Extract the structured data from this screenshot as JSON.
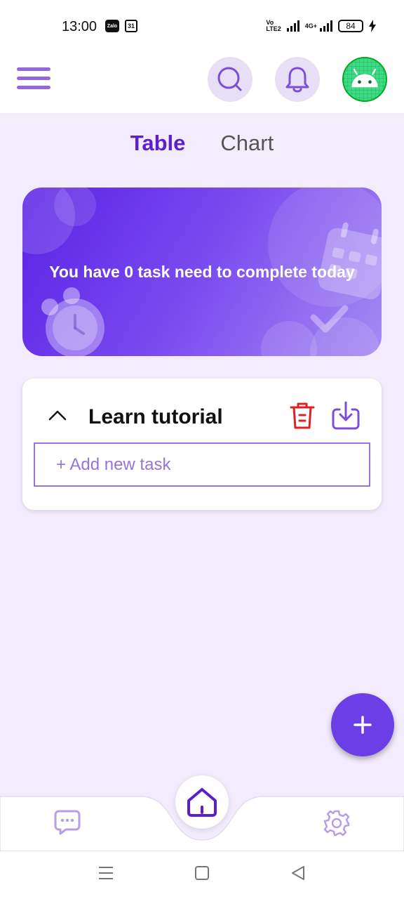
{
  "status_bar": {
    "time": "13:00",
    "zalo_badge": "Zalo",
    "calendar_badge": "31",
    "volte_label": "Vo LTE2",
    "network_label": "4G+",
    "battery": "84"
  },
  "app_bar": {
    "menu_icon": "hamburger-menu-icon",
    "search_icon": "search-icon",
    "bell_icon": "bell-icon",
    "avatar_icon": "android-icon"
  },
  "tabs": [
    {
      "label": "Table",
      "active": true
    },
    {
      "label": "Chart",
      "active": false
    }
  ],
  "banner": {
    "text": "You have 0 task need to complete today"
  },
  "task_group": {
    "title": "Learn tutorial",
    "add_task_label": "+ Add new task",
    "trash_color": "#e02020",
    "accent_color": "#7c4ddb"
  },
  "fab": {
    "icon": "plus-icon"
  },
  "bottom_nav": {
    "items": [
      "chat-icon",
      "home-icon",
      "settings-icon"
    ]
  },
  "colors": {
    "primary": "#5b1fd0",
    "background": "#f3ecfd"
  }
}
